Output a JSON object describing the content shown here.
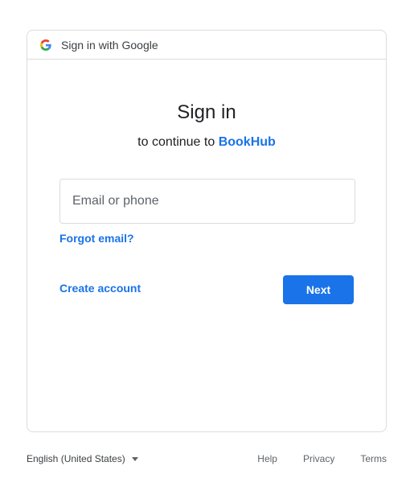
{
  "header": {
    "logo_icon": "google-g-icon",
    "text": "Sign in with Google"
  },
  "main": {
    "title": "Sign in",
    "subtitle_prefix": "to continue to",
    "app_name": "BookHub",
    "email": {
      "placeholder": "Email or phone",
      "value": ""
    },
    "forgot_email": "Forgot email?",
    "create_account": "Create account",
    "next": "Next"
  },
  "footer": {
    "language": "English (United States)",
    "links": [
      "Help",
      "Privacy",
      "Terms"
    ]
  },
  "colors": {
    "accent": "#1a73e8",
    "border": "#dadce0",
    "text": "#202124"
  }
}
